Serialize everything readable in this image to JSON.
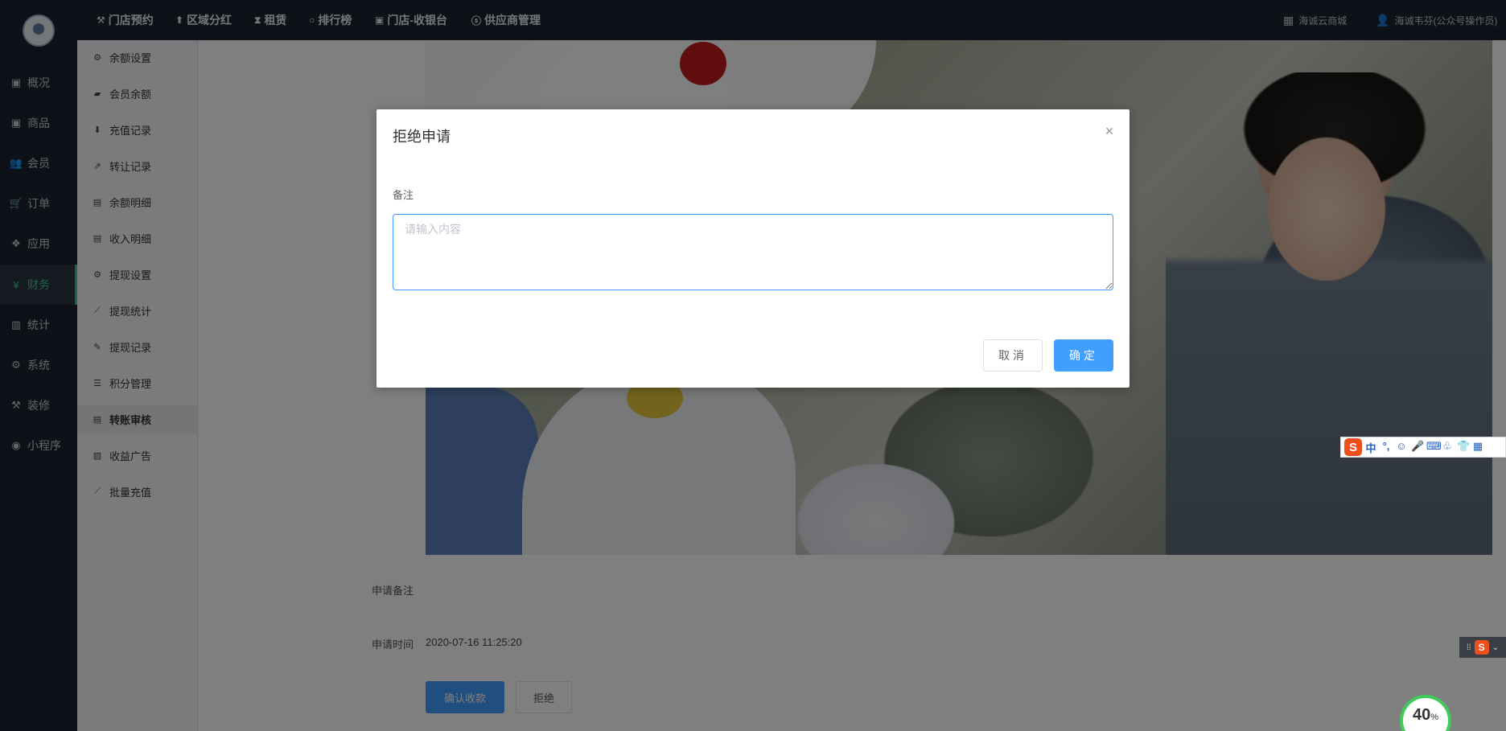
{
  "topnav": [
    {
      "icon": "hammer-icon",
      "glyph": "⚒",
      "label": "门店预约"
    },
    {
      "icon": "pin-icon",
      "glyph": "⬆",
      "label": "区域分红"
    },
    {
      "icon": "hourglass-icon",
      "glyph": "⧗",
      "label": "租赁"
    },
    {
      "icon": "circle-icon",
      "glyph": "○",
      "label": "排行榜"
    },
    {
      "icon": "cashier-icon",
      "glyph": "▣",
      "label": "门店-收银台"
    },
    {
      "icon": "skype-icon",
      "glyph": "ⓢ",
      "label": "供应商管理"
    }
  ],
  "topright": {
    "mall": {
      "icon": "grid-icon",
      "glyph": "▦",
      "label": "海诚云商城"
    },
    "user": {
      "icon": "user-icon",
      "glyph": "👤",
      "label": "海诚韦芬(公众号操作员)"
    }
  },
  "sidebar": [
    {
      "icon": "dashboard-icon",
      "glyph": "▣",
      "label": "概况"
    },
    {
      "icon": "goods-icon",
      "glyph": "▣",
      "label": "商品"
    },
    {
      "icon": "users-icon",
      "glyph": "👥",
      "label": "会员"
    },
    {
      "icon": "cart-icon",
      "glyph": "🛒",
      "label": "订单"
    },
    {
      "icon": "apps-icon",
      "glyph": "❖",
      "label": "应用"
    },
    {
      "icon": "yen-icon",
      "glyph": "¥",
      "label": "财务",
      "active": true
    },
    {
      "icon": "chart-icon",
      "glyph": "▥",
      "label": "统计"
    },
    {
      "icon": "cogs-icon",
      "glyph": "⚙",
      "label": "系统"
    },
    {
      "icon": "decorate-icon",
      "glyph": "⚒",
      "label": "装修"
    },
    {
      "icon": "wechat-icon",
      "glyph": "◉",
      "label": "小程序"
    }
  ],
  "submenu": [
    {
      "icon": "gear-icon",
      "glyph": "⚙",
      "label": "余额设置"
    },
    {
      "icon": "book-icon",
      "glyph": "▰",
      "label": "会员余额"
    },
    {
      "icon": "download-icon",
      "glyph": "⬇",
      "label": "充值记录"
    },
    {
      "icon": "external-link-icon",
      "glyph": "⇗",
      "label": "转让记录"
    },
    {
      "icon": "file-icon",
      "glyph": "▤",
      "label": "余额明细"
    },
    {
      "icon": "file-icon",
      "glyph": "▤",
      "label": "收入明细"
    },
    {
      "icon": "gear-icon",
      "glyph": "⚙",
      "label": "提现设置"
    },
    {
      "icon": "line-chart-icon",
      "glyph": "⟋",
      "label": "提现统计"
    },
    {
      "icon": "pencil-icon",
      "glyph": "✎",
      "label": "提现记录"
    },
    {
      "icon": "database-icon",
      "glyph": "☰",
      "label": "积分管理"
    },
    {
      "icon": "file-icon",
      "glyph": "▤",
      "label": "转账审核",
      "active": true
    },
    {
      "icon": "image-icon",
      "glyph": "▨",
      "label": "收益广告"
    },
    {
      "icon": "line-chart-icon",
      "glyph": "⟋",
      "label": "批量充值"
    }
  ],
  "main": {
    "remark_label": "申请备注",
    "time_label": "申请时间",
    "time_value": "2020-07-16 11:25:20",
    "confirm_button": "确认收款",
    "reject_button": "拒绝"
  },
  "dialog": {
    "title": "拒绝申请",
    "close_glyph": "×",
    "field_label": "备注",
    "placeholder": "请输入内容",
    "cancel_button": "取消",
    "ok_button": "确定"
  },
  "ime": {
    "logo": "S",
    "items": [
      "中",
      "°,",
      "☺",
      "🎤",
      "⌨",
      "♧",
      "👕",
      "▦"
    ]
  },
  "progress": {
    "value": "40",
    "unit": "%"
  }
}
